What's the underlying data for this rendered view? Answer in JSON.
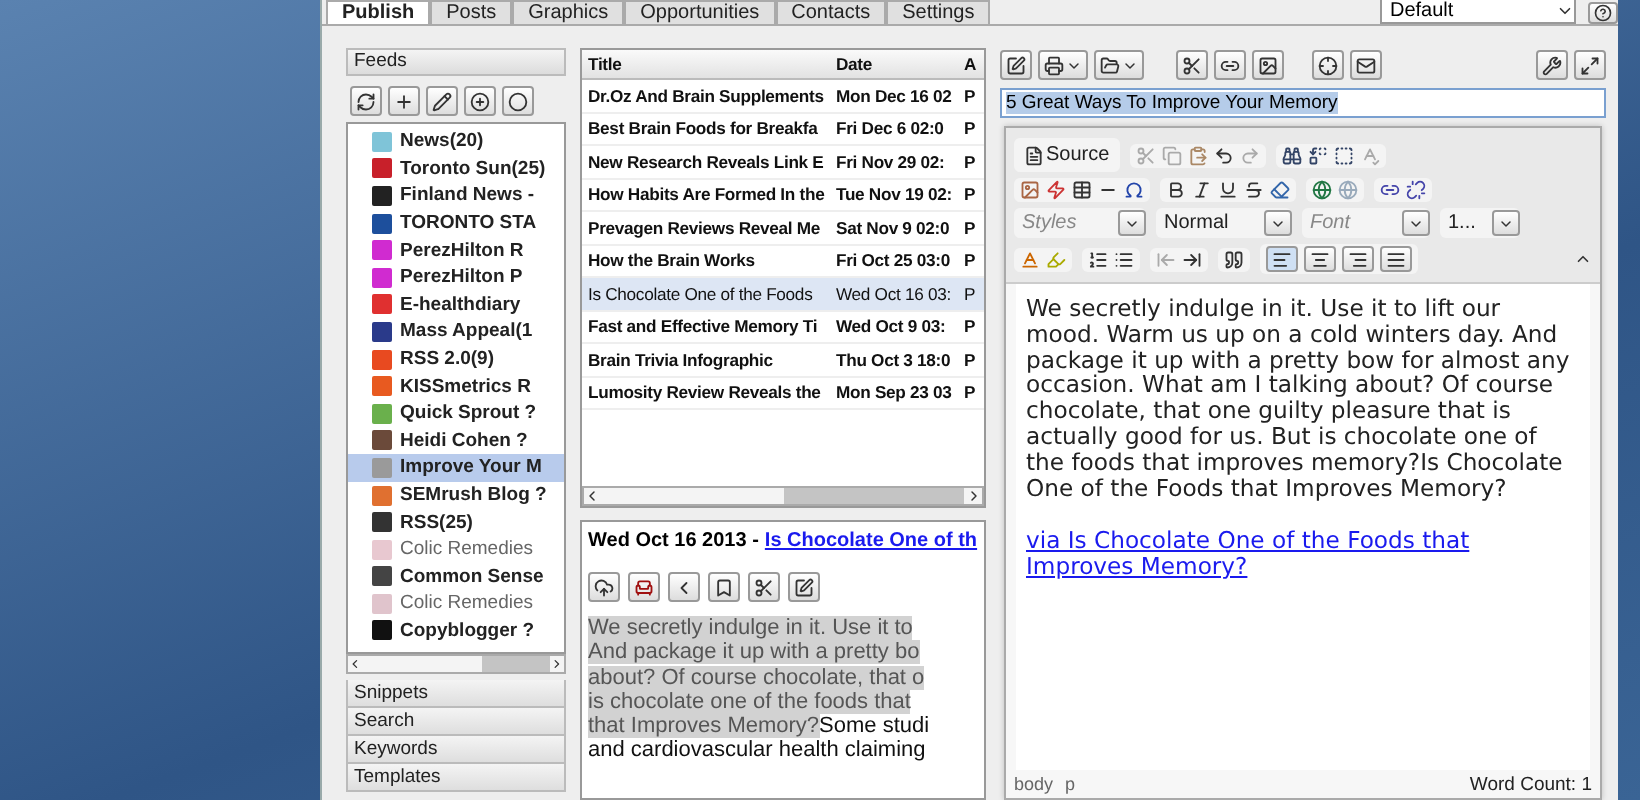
{
  "tabs": [
    {
      "label": "Publish",
      "selected": true
    },
    {
      "label": "Posts",
      "selected": false
    },
    {
      "label": "Graphics",
      "selected": false
    },
    {
      "label": "Opportunities",
      "selected": false
    },
    {
      "label": "Contacts",
      "selected": false
    },
    {
      "label": "Settings",
      "selected": false
    }
  ],
  "profile": {
    "value": "Default"
  },
  "feeds": {
    "title": "Feeds",
    "items": [
      {
        "name": "News(20)",
        "color": "#7fc4d8",
        "unread": true,
        "selected": false
      },
      {
        "name": "Toronto Sun(25)",
        "color": "#c8202a",
        "unread": true,
        "selected": false
      },
      {
        "name": "Finland News -",
        "color": "#222222",
        "unread": true,
        "selected": false
      },
      {
        "name": "TORONTO STA",
        "color": "#1d4f9c",
        "unread": true,
        "selected": false
      },
      {
        "name": "PerezHilton R",
        "color": "#d02bd0",
        "unread": true,
        "selected": false
      },
      {
        "name": "PerezHilton P",
        "color": "#d02bd0",
        "unread": true,
        "selected": false
      },
      {
        "name": "E-healthdiary",
        "color": "#e03030",
        "unread": true,
        "selected": false
      },
      {
        "name": "Mass Appeal(1",
        "color": "#2a3a8a",
        "unread": true,
        "selected": false
      },
      {
        "name": "RSS 2.0(9)",
        "color": "#e84a20",
        "unread": true,
        "selected": false
      },
      {
        "name": "KISSmetrics R",
        "color": "#e85a20",
        "unread": true,
        "selected": false
      },
      {
        "name": "Quick Sprout ?",
        "color": "#6ab04c",
        "unread": true,
        "selected": false
      },
      {
        "name": "Heidi Cohen ?",
        "color": "#6b4a3a",
        "unread": true,
        "selected": false
      },
      {
        "name": "Improve Your M",
        "color": "#9a9a9a",
        "unread": true,
        "selected": true
      },
      {
        "name": "SEMrush Blog ?",
        "color": "#e07030",
        "unread": true,
        "selected": false
      },
      {
        "name": "RSS(25)",
        "color": "#333333",
        "unread": true,
        "selected": false
      },
      {
        "name": "Colic Remedies",
        "color": "#e8c8d0",
        "unread": false,
        "selected": false
      },
      {
        "name": "Common Sense",
        "color": "#444444",
        "unread": true,
        "selected": false
      },
      {
        "name": "Colic Remedies",
        "color": "#e0c4cc",
        "unread": false,
        "selected": false
      },
      {
        "name": "Copyblogger ?",
        "color": "#111111",
        "unread": true,
        "selected": false
      }
    ]
  },
  "accordion": [
    "Snippets",
    "Search",
    "Keywords",
    "Templates"
  ],
  "posts": {
    "columns": [
      "Title",
      "Date",
      "A"
    ],
    "rows": [
      {
        "title": "Dr.Oz And Brain Supplements",
        "date": "Mon Dec 16 02",
        "column_3": "P",
        "unread": true,
        "selected": false
      },
      {
        "title": "Best Brain Foods for Breakfa",
        "date": "Fri Dec 6 02:0",
        "column_3": "P",
        "unread": true,
        "selected": false
      },
      {
        "title": "New Research Reveals Link E",
        "date": "Fri Nov 29 02:",
        "column_3": "P",
        "unread": true,
        "selected": false
      },
      {
        "title": "How Habits Are Formed In the",
        "date": "Tue Nov 19 02:",
        "column_3": "P",
        "unread": true,
        "selected": false
      },
      {
        "title": "Prevagen Reviews Reveal Me",
        "date": "Sat Nov 9 02:0",
        "column_3": "P",
        "unread": true,
        "selected": false
      },
      {
        "title": "How the Brain Works",
        "date": "Fri Oct 25 03:0",
        "column_3": "P",
        "unread": true,
        "selected": false
      },
      {
        "title": "Is Chocolate One of the Foods",
        "date": "Wed Oct 16 03:",
        "column_3": "P",
        "unread": false,
        "selected": true
      },
      {
        "title": "Fast and Effective Memory Ti",
        "date": "Wed Oct 9 03:",
        "column_3": "P",
        "unread": true,
        "selected": false
      },
      {
        "title": "Brain Trivia Infographic",
        "date": "Thu Oct 3 18:0",
        "column_3": "P",
        "unread": true,
        "selected": false
      },
      {
        "title": "Lumosity Review Reveals the",
        "date": "Mon Sep 23 03",
        "column_3": "P",
        "unread": true,
        "selected": false
      }
    ]
  },
  "preview": {
    "date": "Wed Oct 16 2013 -",
    "link": "Is Chocolate One of th",
    "lines": [
      {
        "selected_text": "We secretly indulge in it. Use it to"
      },
      {
        "selected_text": "And package it up with a pretty bo"
      },
      {
        "selected_text": "about? Of course chocolate, that o"
      },
      {
        "selected_text": "is chocolate one of the foods that"
      },
      {
        "selected_text": "that Improves Memory?",
        "text": "Some studi"
      },
      {
        "text": "and cardiovascular health claiming"
      }
    ]
  },
  "editor": {
    "title_value": "5 Great Ways To Improve Your Memory",
    "source_label": "Source",
    "combos": [
      {
        "kind": "placeholder",
        "text": "Styles"
      },
      {
        "kind": "value",
        "text": "Normal"
      },
      {
        "kind": "placeholder",
        "text": "Font"
      },
      {
        "kind": "value",
        "text": "1..."
      }
    ],
    "alignment": [
      {
        "selected": true
      },
      {
        "selected": false
      },
      {
        "selected": false
      },
      {
        "selected": false
      }
    ],
    "body": "We secretly indulge in it. Use it to lift our mood. Warm us up on a cold winters day. And package it up with a pretty bow for almost any occasion. What am I talking about? Of course chocolate, that one guilty pleasure that is actually good for us. But is chocolate one of the foods that improves memory?Is Chocolate One of the Foods that Improves Memory?",
    "link": "via Is Chocolate One of the Foods that Improves Memory?",
    "path": [
      "body",
      "p"
    ],
    "word_count": "Word Count: 1"
  }
}
